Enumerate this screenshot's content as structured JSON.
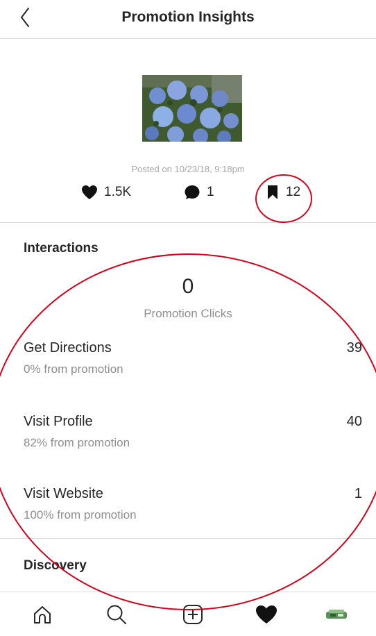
{
  "header": {
    "title": "Promotion Insights",
    "back_icon": "chevron-left-icon"
  },
  "post": {
    "thumbnail_alt": "hydrangea photo",
    "posted_on": "Posted on 10/23/18, 9:18pm",
    "likes": "1.5K",
    "comments": "1",
    "saves": "12"
  },
  "interactions": {
    "title": "Interactions",
    "promotion_clicks_value": "0",
    "promotion_clicks_label": "Promotion Clicks",
    "rows": [
      {
        "label": "Get Directions",
        "sub": "0% from promotion",
        "value": "39"
      },
      {
        "label": "Visit Profile",
        "sub": "82% from promotion",
        "value": "40"
      },
      {
        "label": "Visit Website",
        "sub": "100% from promotion",
        "value": "1"
      }
    ]
  },
  "discovery": {
    "title": "Discovery"
  },
  "bottom_nav": {
    "items": [
      "home-icon",
      "search-icon",
      "new-post-icon",
      "activity-heart-icon",
      "profile-avatar"
    ]
  },
  "colors": {
    "text": "#262626",
    "secondary": "#8e8e8e",
    "muted": "#a8a8a8",
    "divider": "#dbdbdb",
    "annotation": "#d9001b"
  }
}
